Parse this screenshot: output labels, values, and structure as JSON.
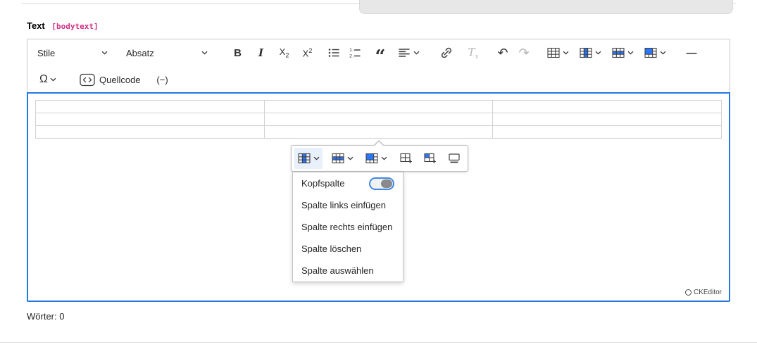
{
  "field": {
    "label": "Text",
    "key": "[bodytext]"
  },
  "toolbar": {
    "styles_label": "Stile",
    "paragraph_label": "Absatz",
    "source_label": "Quellcode",
    "soft_hyphen_label": "(−)",
    "icons": {
      "bold": "B",
      "italic": "I",
      "script_base": "X",
      "script_digit": "2",
      "quote": "“",
      "undo": "↶",
      "redo": "↷",
      "remove_format_base": "T",
      "remove_format_x": "x",
      "special_char": "Ω",
      "horizontal_line": "—"
    }
  },
  "editor": {
    "table_rows": 3,
    "table_cols": 3
  },
  "dropdown": {
    "items": [
      {
        "label": "Kopfspalte",
        "type": "toggle",
        "state": "off"
      },
      {
        "label": "Spalte links einfügen"
      },
      {
        "label": "Spalte rechts einfügen"
      },
      {
        "label": "Spalte löschen"
      },
      {
        "label": "Spalte auswählen"
      }
    ]
  },
  "badge": {
    "label": "CKEditor"
  },
  "footer": {
    "word_count": "Wörter: 0"
  },
  "colors": {
    "accent": "#2977ff",
    "focus_border": "#2478e0",
    "field_key": "#cf2e84"
  }
}
